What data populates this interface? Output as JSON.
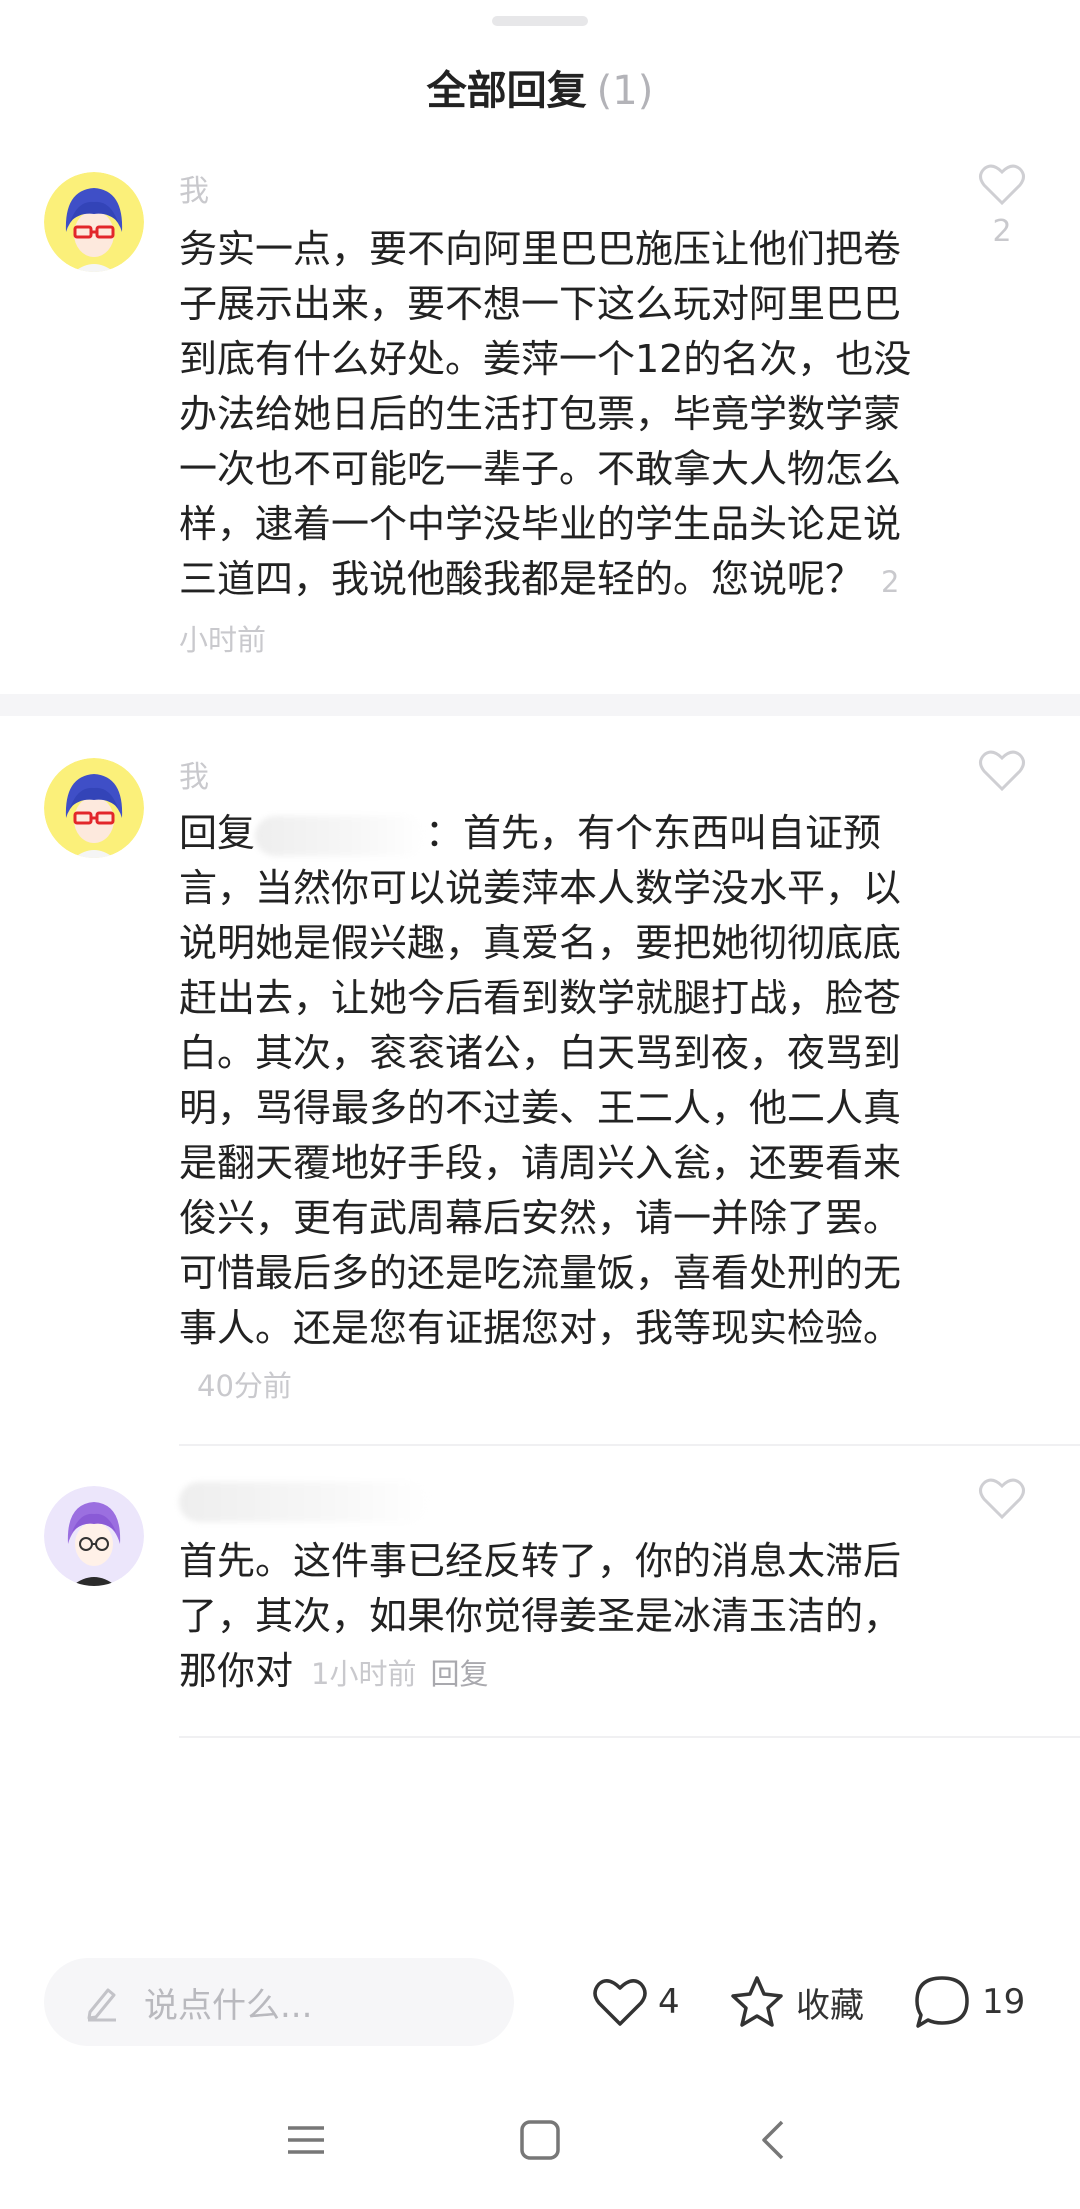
{
  "header": {
    "title": "全部回复",
    "count": "(1)"
  },
  "comments": [
    {
      "author": "我",
      "text": "务实一点，要不向阿里巴巴施压让他们把卷子展示出来，要不想一下这么玩对阿里巴巴到底有什么好处。姜萍一个12的名次，也没办法给她日后的生活打包票，毕竟学数学蒙一次也不可能吃一辈子。不敢拿大人物怎么样，逮着一个中学没毕业的学生品头论足说三道四，我说他酸我都是轻的。您说呢？",
      "time": "2小时前",
      "likes": "2",
      "avatar_icon": "avatar-red-glasses-boy-icon"
    },
    {
      "author": "我",
      "reply_prefix": "回复",
      "text": "：首先，有个东西叫自证预言，当然你可以说姜萍本人数学没水平，以说明她是假兴趣，真爱名，要把她彻彻底底赶出去，让她今后看到数学就腿打战，脸苍白。其次，衮衮诸公，白天骂到夜，夜骂到明，骂得最多的不过姜、王二人，他二人真是翻天覆地好手段，请周兴入瓮，还要看来俊兴，更有武周幕后安然，请一并除了罢。可惜最后多的还是吃流量饭，喜看处刑的无事人。还是您有证据您对，我等现实检验。",
      "time": "40分前",
      "avatar_icon": "avatar-red-glasses-boy-icon"
    },
    {
      "text": "首先。这件事已经反转了，你的消息太滞后了，其次，如果你觉得姜圣是冰清玉洁的，那你对",
      "time": "1小时前",
      "reply_label": "回复",
      "avatar_icon": "avatar-purple-hair-icon"
    }
  ],
  "bottom_bar": {
    "input_placeholder": "说点什么...",
    "likes": "4",
    "favorite_label": "收藏",
    "comments": "19"
  },
  "colors": {
    "muted": "#c9c9cd",
    "text": "#222222",
    "avatar_bg_yellow": "#fbf07a",
    "avatar_bg_lavender": "#ece6fb"
  }
}
